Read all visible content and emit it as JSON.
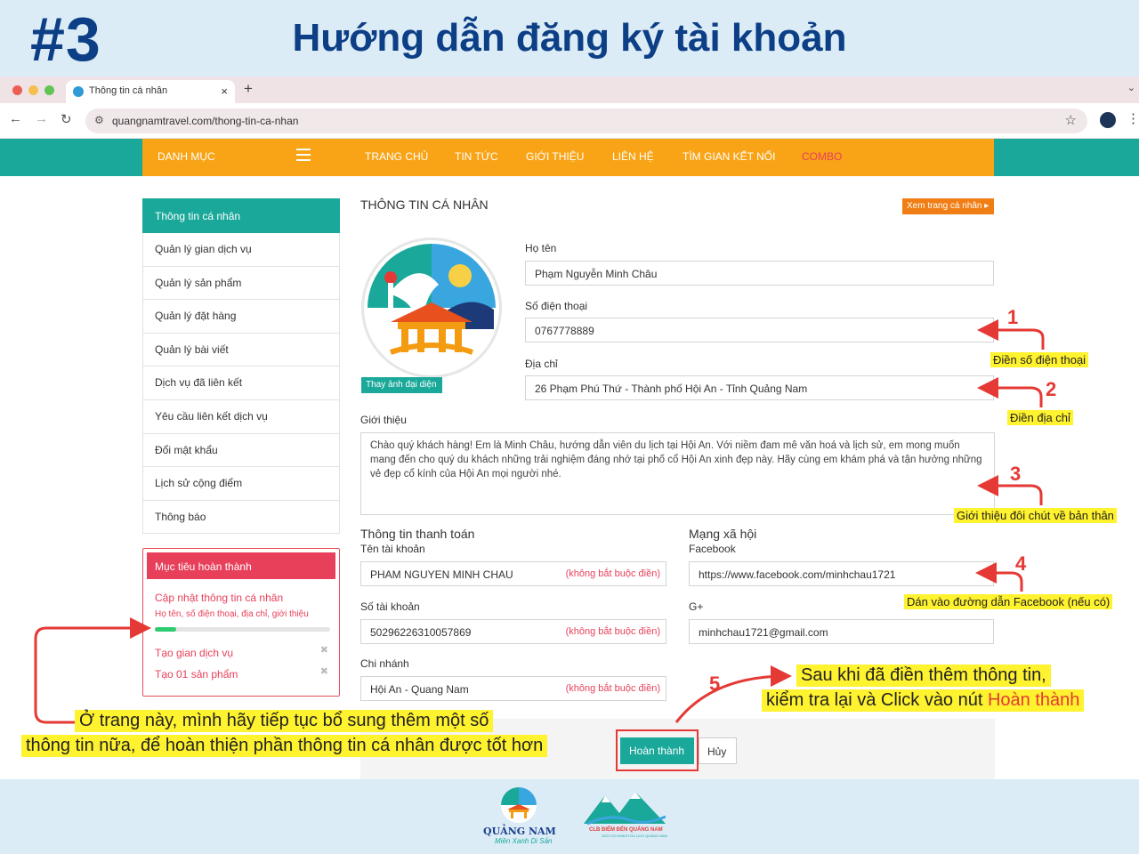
{
  "slide": {
    "step": "#3",
    "title": "Hướng dẫn đăng ký tài khoản"
  },
  "browser": {
    "tab_title": "Thông tin cá nhân",
    "tab_close": "×",
    "new_tab": "+",
    "url": "quangnamtravel.com/thong-tin-ca-nhan",
    "back": "←",
    "forward": "→",
    "reload": "↻",
    "star": "☆",
    "menu": "⋮",
    "tab_menu": "⌄"
  },
  "site_nav": {
    "category": "DANH MỤC",
    "items": [
      "TRANG CHỦ",
      "TIN TỨC",
      "GIỚI THIỆU",
      "LIÊN HỆ",
      "TÌM GIAN KẾT NỐI",
      "COMBO"
    ]
  },
  "sidebar": {
    "items": [
      "Thông tin cá nhân",
      "Quản lý gian dịch vụ",
      "Quản lý sản phẩm",
      "Quản lý đặt hàng",
      "Quản lý bài viết",
      "Dịch vụ đã liên kết",
      "Yêu cầu liên kết dịch vụ",
      "Đổi mật khẩu",
      "Lịch sử cộng điểm",
      "Thông báo"
    ]
  },
  "goals": {
    "title": "Mục tiêu hoàn thành",
    "current": "Cập nhật thông tin cá nhân",
    "current_detail": "Họ tên, số điện thoại, địa chỉ, giới thiệu",
    "progress": 0.12,
    "pending": [
      "Tạo gian dịch vụ",
      "Tạo 01 sản phẩm"
    ],
    "close_glyph": "✖"
  },
  "profile": {
    "title": "THÔNG TIN CÁ NHÂN",
    "view_profile": "Xem trang cá nhân ▸",
    "change_avatar": "Thay ảnh đại diện",
    "name_label": "Họ tên",
    "name": "Phạm Nguyễn Minh Châu",
    "phone_label": "Số điện thoại",
    "phone": "0767778889",
    "address_label": "Địa chỉ",
    "address": "26 Phạm Phú Thứ - Thành phố Hội An - Tỉnh Quảng Nam",
    "intro_label": "Giới thiệu",
    "intro": "Chào quý khách hàng! Em là Minh Châu, hướng dẫn viên du lịch tại Hội An. Với niềm đam mê văn hoá và lịch sử, em mong muốn mang đến cho quý du khách những trải nghiệm đáng nhớ tại phố cổ Hội An xinh đẹp này. Hãy cùng em khám phá và tận hưởng những vẻ đẹp cổ kính của Hội An mọi người nhé."
  },
  "payment": {
    "title": "Thông tin thanh toán",
    "account_name_label": "Tên tài khoản",
    "account_name": "PHAM NGUYEN MINH CHAU",
    "account_number_label": "Số tài khoản",
    "account_number": "50296226310057869",
    "branch_label": "Chi nhánh",
    "branch": "Hội An - Quang Nam",
    "optional": "(không bắt buộc điền)"
  },
  "social": {
    "title": "Mạng xã hội",
    "facebook_label": "Facebook",
    "facebook": "https://www.facebook.com/minhchau1721",
    "gplus_label": "G+",
    "gplus": "minhchau1721@gmail.com"
  },
  "actions": {
    "done": "Hoàn thành",
    "cancel": "Hủy"
  },
  "annotations": {
    "n1": "1",
    "t1": "Điền số điện thoại",
    "n2": "2",
    "t2": "Điền địa chỉ",
    "n3": "3",
    "t3": "Giới thiệu đôi chút về bản thân",
    "n4": "4",
    "t4": "Dán vào đường dẫn Facebook (nếu có)",
    "n5": "5",
    "t5_line1": "Sau khi đã điền thêm thông tin,",
    "t5_line2": "kiểm tra lại và Click vào nút ",
    "t5_highlight": "Hoàn thành",
    "tip_line1": "Ở trang này, mình hãy tiếp tục bổ sung thêm một số",
    "tip_line2": "thông tin nữa, để hoàn thiện phần thông tin cá nhân được tốt hơn"
  },
  "logos": {
    "qn_name": "QUẢNG NAM",
    "qn_slogan": "Miền Xanh Di Sản",
    "club_name": "CLB ĐIỂM ĐẾN QUẢNG NAM",
    "club_sub": "GIỚI CÓ KHÁCH DU LỊCH QUẢNG NAM"
  },
  "colors": {
    "teal": "#1aa89a",
    "orange": "#f8a416",
    "red": "#e53935",
    "highlight": "#fff22e",
    "navy": "#0d3f86"
  }
}
